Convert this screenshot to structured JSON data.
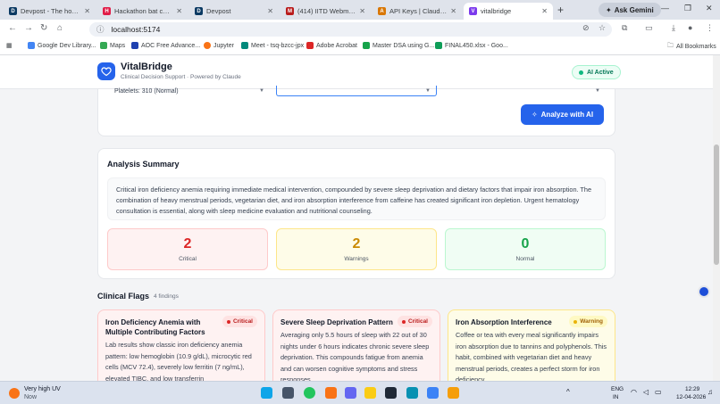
{
  "browser": {
    "tabs": [
      {
        "label": "Devpost - The home fo",
        "fav": "D",
        "color": "#0b3a63"
      },
      {
        "label": "Hackathon bat challeng",
        "fav": "H",
        "color": "#e11d48"
      },
      {
        "label": "Devpost",
        "fav": "D",
        "color": "#0b3a63"
      },
      {
        "label": "(414) IITD Webmail :: In",
        "fav": "M",
        "color": "#b91c1c"
      },
      {
        "label": "API Keys | Claude Platf",
        "fav": "A",
        "color": "#d97706"
      },
      {
        "label": "vitalbridge",
        "fav": "V",
        "color": "#7c3aed"
      }
    ],
    "new_tab": "+",
    "gemini_label": "Ask Gemini",
    "url": "localhost:5174",
    "bookmarks": [
      {
        "label": "Google Dev Library...",
        "color": "#4285f4"
      },
      {
        "label": "Maps",
        "color": "#34a853"
      },
      {
        "label": "AOC Free Advance...",
        "color": "#1e40af"
      },
      {
        "label": "Jupyter",
        "color": "#f97316"
      },
      {
        "label": "Meet - tsq-bzcc-jpx",
        "color": "#00897b"
      },
      {
        "label": "Adobe Acrobat",
        "color": "#dc2626"
      },
      {
        "label": "Master DSA using G...",
        "color": "#16a34a"
      },
      {
        "label": "FINAL450.xlsx - Goo...",
        "color": "#0f9d58"
      }
    ],
    "all_bookmarks": "All Bookmarks"
  },
  "app": {
    "name": "VitalBridge",
    "subtitle": "Clinical Decision Support · Powered by Claude",
    "status": "AI Active",
    "selects": [
      "Platelets: 310 (Normal)",
      "",
      ""
    ],
    "analyze_label": "Analyze with AI",
    "summary_title": "Analysis Summary",
    "summary_text": "Critical iron deficiency anemia requiring immediate medical intervention, compounded by severe sleep deprivation and dietary factors that impair iron absorption. The combination of heavy menstrual periods, vegetarian diet, and iron absorption interference from caffeine has created significant iron depletion. Urgent hematology consultation is essential, along with sleep medicine evaluation and nutritional counseling.",
    "stats": [
      {
        "value": "2",
        "label": "Critical",
        "color": "#dc2626",
        "bg": "#fef2f2",
        "border": "#fecaca"
      },
      {
        "value": "2",
        "label": "Warnings",
        "color": "#ca8a04",
        "bg": "#fefce8",
        "border": "#fde68a"
      },
      {
        "value": "0",
        "label": "Normal",
        "color": "#16a34a",
        "bg": "#f0fdf4",
        "border": "#bbf7d0"
      }
    ],
    "flags_title": "Clinical Flags",
    "flags_count": "4 findings",
    "flags": [
      {
        "title": "Iron Deficiency Anemia with Multiple Contributing Factors",
        "badge": "Critical",
        "body": "Lab results show classic iron deficiency anemia pattern: low hemoglobin (10.9 g/dL), microcytic red cells (MCV 72.4), severely low ferritin (7 ng/mL), elevated TIBC, and low transferrin",
        "bg": "#fef2f2",
        "border": "#fecaca",
        "badge_bg": "#fee2e2",
        "badge_color": "#b91c1c",
        "dot": "#dc2626"
      },
      {
        "title": "Severe Sleep Deprivation Pattern",
        "badge": "Critical",
        "body": "Averaging only 5.5 hours of sleep with 22 out of 30 nights under 6 hours indicates chronic severe sleep deprivation. This compounds fatigue from anemia and can worsen cognitive symptoms and stress responses.",
        "bg": "#fef2f2",
        "border": "#fecaca",
        "badge_bg": "#fee2e2",
        "badge_color": "#b91c1c",
        "dot": "#dc2626"
      },
      {
        "title": "Iron Absorption Interference",
        "badge": "Warning",
        "body": "Coffee or tea with every meal significantly impairs iron absorption due to tannins and polyphenols. This habit, combined with vegetarian diet and heavy menstrual periods, creates a perfect storm for iron deficiency.",
        "bg": "#fefce8",
        "border": "#fde68a",
        "badge_bg": "#fef9c3",
        "badge_color": "#a16207",
        "dot": "#eab308"
      }
    ]
  },
  "taskbar": {
    "weather_line1": "Very high UV",
    "weather_line2": "Now",
    "lang1": "ENG",
    "lang2": "IN",
    "time": "12:29",
    "date": "12-04-2026"
  }
}
